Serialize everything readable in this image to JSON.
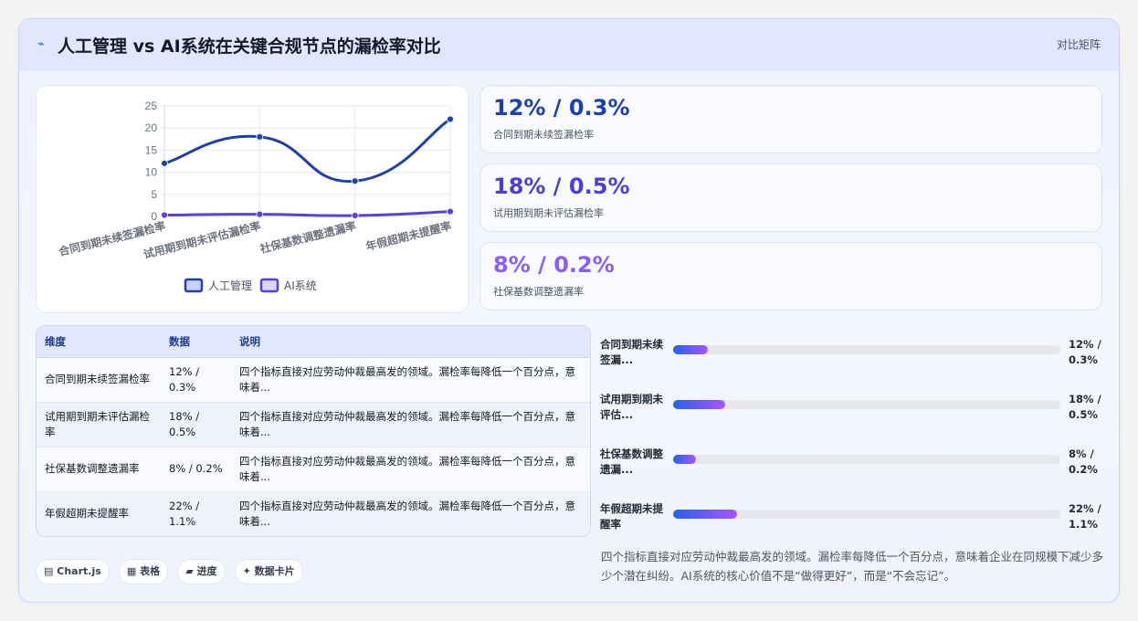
{
  "header": {
    "icon": "chart-line-icon",
    "icon_glyph": "⌁",
    "title": "人工管理 vs AI系统在关键合规节点的漏检率对比",
    "tag": "对比矩阵"
  },
  "chart_data": {
    "type": "line",
    "categories": [
      "合同到期未续签漏检率",
      "试用期到期未评估漏检率",
      "社保基数调整遗漏率",
      "年假超期未提醒率"
    ],
    "series": [
      {
        "name": "人工管理",
        "values": [
          12,
          18,
          8,
          22
        ],
        "color": "#1e40af"
      },
      {
        "name": "AI系统",
        "values": [
          0.3,
          0.5,
          0.2,
          1.1
        ],
        "color": "#5b3fd8"
      }
    ],
    "ylim": [
      0,
      25
    ],
    "yticks": [
      "25",
      "20",
      "15",
      "10",
      "5",
      "0"
    ],
    "legend": "bottom",
    "grid": true
  },
  "kpis": [
    {
      "value": "12% / 0.3%",
      "label": "合同到期未续签漏检率",
      "color": "#1e40af"
    },
    {
      "value": "18% / 0.5%",
      "label": "试用期到期未评估漏检率",
      "color": "#4c3ed4"
    },
    {
      "value": "8% / 0.2%",
      "label": "社保基数调整遗漏率",
      "color": "#8b5cf6"
    }
  ],
  "table": {
    "headers": [
      "维度",
      "数据",
      "说明"
    ],
    "rows": [
      {
        "dim": "合同到期未续签漏检率",
        "data": "12% / 0.3%",
        "desc": "四个指标直接对应劳动仲裁最高发的领域。漏检率每降低一个百分点，意味着..."
      },
      {
        "dim": "试用期到期未评估漏检率",
        "data": "18% / 0.5%",
        "desc": "四个指标直接对应劳动仲裁最高发的领域。漏检率每降低一个百分点，意味着..."
      },
      {
        "dim": "社保基数调整遗漏率",
        "data": "8% / 0.2%",
        "desc": "四个指标直接对应劳动仲裁最高发的领域。漏检率每降低一个百分点，意味着..."
      },
      {
        "dim": "年假超期未提醒率",
        "data": "22% / 1.1%",
        "desc": "四个指标直接对应劳动仲裁最高发的领域。漏检率每降低一个百分点，意味着..."
      }
    ]
  },
  "progress": [
    {
      "label": "合同到期未续签漏...",
      "value": "12% / 0.3%",
      "fraction": 0.09
    },
    {
      "label": "试用期到期未评估...",
      "value": "18% / 0.5%",
      "fraction": 0.135
    },
    {
      "label": "社保基数调整遗漏...",
      "value": "8% / 0.2%",
      "fraction": 0.06
    },
    {
      "label": "年假超期未提醒率",
      "value": "22% / 1.1%",
      "fraction": 0.165
    }
  ],
  "chips": [
    {
      "icon": "chart-icon",
      "glyph": "▤",
      "label": "Chart.js"
    },
    {
      "icon": "table-icon",
      "glyph": "▦",
      "label": "表格"
    },
    {
      "icon": "progress-icon",
      "glyph": "▰",
      "label": "进度"
    },
    {
      "icon": "sparkle-icon",
      "glyph": "✦",
      "label": "数据卡片"
    }
  ],
  "summary": "四个指标直接对应劳动仲裁最高发的领域。漏检率每降低一个百分点，意味着企业在同规模下减少多少个潜在纠纷。AI系统的核心价值不是“做得更好”，而是“不会忘记”。"
}
